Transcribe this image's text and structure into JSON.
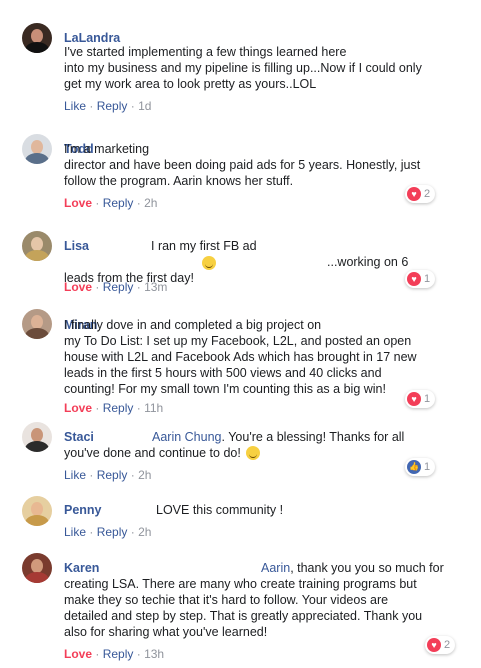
{
  "comments": [
    {
      "name": "LaLandra",
      "text": "          I've started implementing a few things learned here\ninto my business and my pipeline is filling up...Now if I could only\nget my work area to look pretty as yours..LOL",
      "reaction": "Like",
      "reply": "Reply",
      "time": "1d"
    },
    {
      "name": "Todd",
      "text": "                                               I'm a marketing\ndirector and have been doing paid ads for 5 years. Honestly, just\nfollow the program. Aarin knows her stuff.",
      "reaction": "Love",
      "reply": "Reply",
      "time": "2h",
      "react_count": "2"
    },
    {
      "name": "Lisa",
      "text_a": "I ran my first FB ad",
      "text_b": "...working on 6\nleads from the first day!",
      "reaction": "Love",
      "reply": "Reply",
      "time": "13m",
      "react_count": "1"
    },
    {
      "name": "Miran",
      "text": "                           I finally dove in and completed a big project on\nmy To Do List: I set up my Facebook, L2L, and posted an open\nhouse with L2L and Facebook Ads which has brought in 17 new\nleads in the first 5 hours with 500 views and 40 clicks and\ncounting! For my small town I'm counting this as a big win!",
      "reaction": "Love",
      "reply": "Reply",
      "time": "11h",
      "react_count": "1"
    },
    {
      "name": "Staci",
      "mention": "Aarin Chung",
      "text": ". You're a blessing! Thanks for all\nyou've done and continue to do!",
      "reaction": "Like",
      "reply": "Reply",
      "time": "2h",
      "react_count": "1"
    },
    {
      "name": "Penny",
      "text": "LOVE this community !",
      "reaction": "Like",
      "reply": "Reply",
      "time": "2h"
    },
    {
      "name": "Karen",
      "mention": "Aarin",
      "text": ", thank you you so much for\ncreating LSA. There are many who create training programs but\nmake they so techie that it's hard to follow. Your videos are\ndetailed and step by step. That is greatly appreciated. Thank you\nalso for sharing what you've learned!",
      "reaction": "Love",
      "reply": "Reply",
      "time": "13h",
      "react_count": "2"
    }
  ],
  "separator": "·",
  "colors": {
    "link": "#385898",
    "love": "#f33e58",
    "meta": "#90949c"
  }
}
